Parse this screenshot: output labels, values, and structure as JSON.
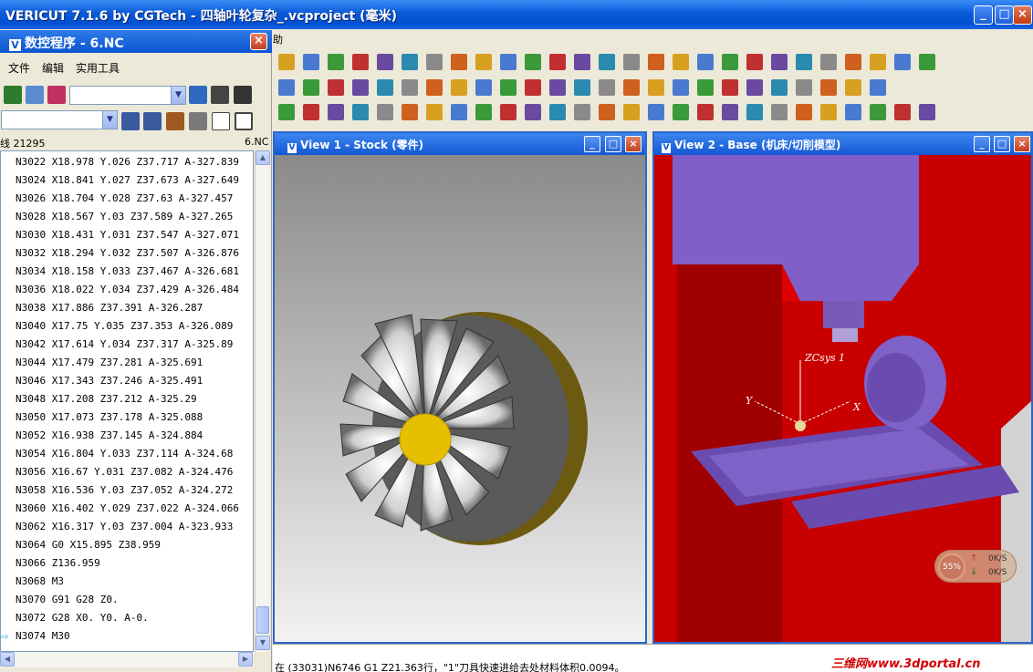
{
  "window": {
    "title": "VERICUT 7.1.6 by CGTech - 四轴叶轮复杂_.vcproject (毫米)",
    "buttons": [
      "_",
      "□",
      "×"
    ]
  },
  "nc_panel": {
    "title": "数控程序 - 6.NC",
    "close_label": "×",
    "menu": [
      "文件",
      "编辑",
      "实用工具"
    ],
    "status_left": "线 21295",
    "status_right": "6.NC",
    "lines": [
      "N3022 X18.978 Y.026 Z37.717 A-327.839",
      "N3024 X18.841 Y.027 Z37.673 A-327.649",
      "N3026 X18.704 Y.028 Z37.63 A-327.457",
      "N3028 X18.567 Y.03 Z37.589 A-327.265",
      "N3030 X18.431 Y.031 Z37.547 A-327.071",
      "N3032 X18.294 Y.032 Z37.507 A-326.876",
      "N3034 X18.158 Y.033 Z37.467 A-326.681",
      "N3036 X18.022 Y.034 Z37.429 A-326.484",
      "N3038 X17.886 Z37.391 A-326.287",
      "N3040 X17.75 Y.035 Z37.353 A-326.089",
      "N3042 X17.614 Y.034 Z37.317 A-325.89",
      "N3044 X17.479 Z37.281 A-325.691",
      "N3046 X17.343 Z37.246 A-325.491",
      "N3048 X17.208 Z37.212 A-325.29",
      "N3050 X17.073 Z37.178 A-325.088",
      "N3052 X16.938 Z37.145 A-324.884",
      "N3054 X16.804 Y.033 Z37.114 A-324.68",
      "N3056 X16.67 Y.031 Z37.082 A-324.476",
      "N3058 X16.536 Y.03 Z37.052 A-324.272",
      "N3060 X16.402 Y.029 Z37.022 A-324.066",
      "N3062 X16.317 Y.03 Z37.004 A-323.933",
      "N3064 G0 X15.895 Z38.959",
      "N3066 Z136.959",
      "N3068 M3",
      "N3070 G91 G28 Z0.",
      "N3072 G28 X0. Y0. A-0.",
      "N3074 M30"
    ]
  },
  "main": {
    "menu_fragment": "助"
  },
  "views": [
    {
      "title": "View 1 - Stock (零件)"
    },
    {
      "title": "View 2 - Base (机床/切削模型)"
    }
  ],
  "view2_labels": {
    "csys": "ZCsys 1",
    "x_axis": "X",
    "y_axis": "Y"
  },
  "gauge": {
    "percent": "55%",
    "up": "0K/S",
    "down": "0K/S"
  },
  "log": {
    "line": "在 (33031)N6746 G1 Z21.363行，\"1\"刀具快速进给去处材料体积0.0094。",
    "watermark": "三维网www.3dportal.cn"
  }
}
